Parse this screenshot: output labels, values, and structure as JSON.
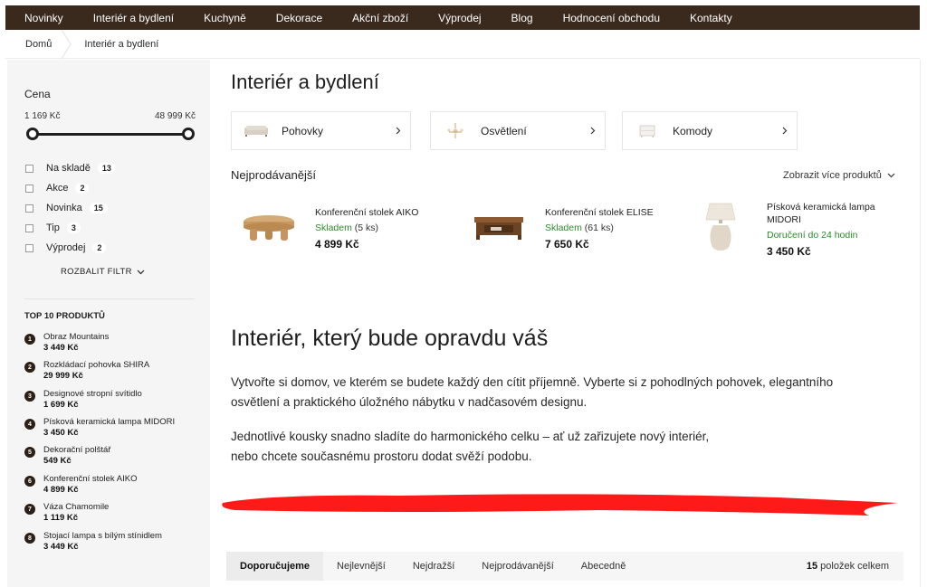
{
  "nav": [
    "Novinky",
    "Interiér a bydlení",
    "Kuchyně",
    "Dekorace",
    "Akční zboží",
    "Výprodej",
    "Blog",
    "Hodnocení obchodu",
    "Kontakty"
  ],
  "breadcrumb": {
    "home": "Domů",
    "current": "Interiér a bydlení"
  },
  "sidebar": {
    "price_heading": "Cena",
    "price_min": "1 169 Kč",
    "price_max": "48 999 Kč",
    "filters": [
      {
        "label": "Na skladě",
        "count": "13"
      },
      {
        "label": "Akce",
        "count": "2"
      },
      {
        "label": "Novinka",
        "count": "15"
      },
      {
        "label": "Tip",
        "count": "3"
      },
      {
        "label": "Výprodej",
        "count": "2"
      }
    ],
    "expand_label": "ROZBALIT FILTR",
    "top10_heading": "TOP 10 PRODUKTŮ",
    "top10": [
      {
        "num": "1",
        "name": "Obraz Mountains",
        "price": "3 449 Kč"
      },
      {
        "num": "2",
        "name": "Rozkládací pohovka SHIRA",
        "price": "29 999 Kč"
      },
      {
        "num": "3",
        "name": "Designové stropní svítidlo",
        "price": "1 699 Kč"
      },
      {
        "num": "4",
        "name": "Písková keramická lampa MIDORI",
        "price": "3 450 Kč"
      },
      {
        "num": "5",
        "name": "Dekorační polštář",
        "price": "549 Kč"
      },
      {
        "num": "6",
        "name": "Konferenční stolek AIKO",
        "price": "4 899 Kč"
      },
      {
        "num": "7",
        "name": "Váza Chamomile",
        "price": "1 119 Kč"
      },
      {
        "num": "8",
        "name": "Stojací lampa s bílým stínidlem",
        "price": "3 449 Kč"
      }
    ]
  },
  "main": {
    "title": "Interiér a bydlení",
    "categories": [
      {
        "label": "Pohovky",
        "icon": "sofa-icon"
      },
      {
        "label": "Osvětlení",
        "icon": "chandelier-icon"
      },
      {
        "label": "Komody",
        "icon": "dresser-icon"
      }
    ],
    "bestsellers_heading": "Nejprodávanější",
    "more_products": "Zobrazit více produktů",
    "products": [
      {
        "name": "Konferenční stolek AIKO",
        "stock": "Skladem",
        "qty": "(5 ks)",
        "price": "4 899 Kč"
      },
      {
        "name": "Konferenční stolek ELISE",
        "stock": "Skladem",
        "qty": "(61 ks)",
        "price": "7 650 Kč"
      },
      {
        "name_line1": "Písková keramická lampa",
        "name_line2": "MIDORI",
        "stock": "Doručení do 24 hodin",
        "price": "3 450 Kč"
      }
    ],
    "hero_title": "Interiér, který bude opravdu váš",
    "para1_line1": "Vytvořte si domov, ve kterém se budete každý den cítit příjemně. Vyberte si z pohodlných pohovek, elegantního",
    "para1_line2": "osvětlení a praktického úložného nábytku v nadčasovém designu.",
    "para2_line1": "Jednotlivé kousky snadno sladíte do harmonického celku – ať už zařizujete nový interiér,",
    "para2_line2": "nebo chcete současnému prostoru dodat svěží podobu."
  },
  "sort": {
    "tabs": [
      "Doporučujeme",
      "Nejlevnější",
      "Nejdražší",
      "Nejprodávanější",
      "Abecedně"
    ],
    "active_index": 0,
    "total_count": "15",
    "total_suffix": "položek celkem"
  },
  "colors": {
    "nav_bg": "#3a2a1d",
    "in_stock": "#2e8a2e",
    "redact_stroke": "#ff1a1a"
  }
}
